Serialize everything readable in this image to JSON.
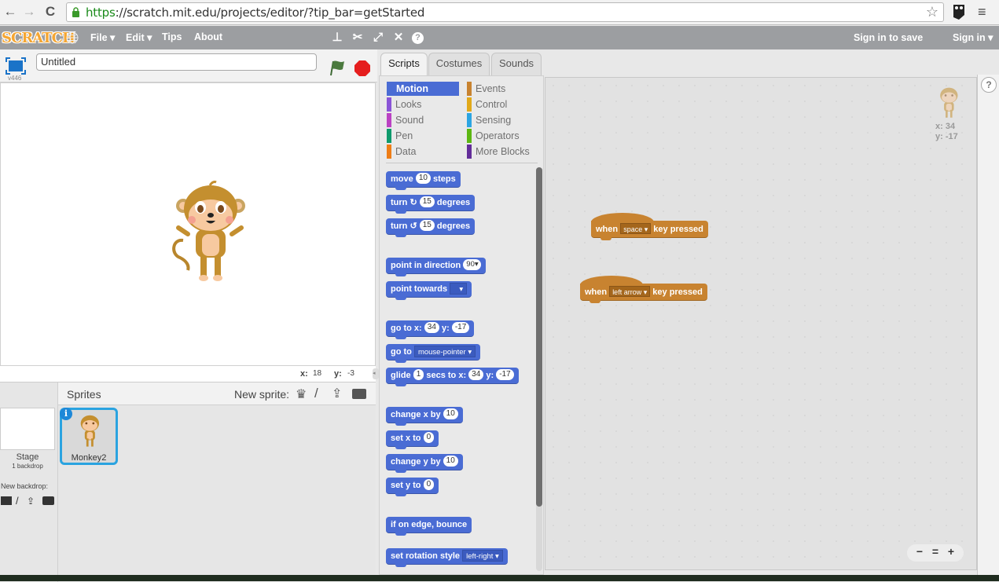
{
  "browser": {
    "url_protocol": "https",
    "url_rest": "://scratch.mit.edu/projects/editor/?tip_bar=getStarted",
    "icons": [
      "back-icon",
      "forward-icon",
      "reload-icon",
      "lock-icon",
      "star-icon",
      "extension-owl-icon",
      "menu-icon"
    ]
  },
  "menubar": {
    "logo": "SCRATCH",
    "file": "File ▾",
    "edit": "Edit ▾",
    "tips": "Tips",
    "about": "About",
    "sign_in_to_save": "Sign in to save",
    "sign_in": "Sign in ▾",
    "tool_icons": [
      "duplicate-stamp-icon",
      "cut-scissors-icon",
      "grow-icon",
      "shrink-icon",
      "help-icon"
    ]
  },
  "stage": {
    "version": "v446",
    "project_title": "Untitled",
    "mouse_x_label": "x:",
    "mouse_x": "18",
    "mouse_y_label": "y:",
    "mouse_y": "-3"
  },
  "sprites_pane": {
    "title": "Sprites",
    "new_sprite_label": "New sprite:",
    "stage_label": "Stage",
    "stage_backdrops": "1 backdrop",
    "new_backdrop_label": "New backdrop:",
    "sprites": [
      {
        "name": "Monkey2",
        "selected": true
      }
    ]
  },
  "tabs": [
    {
      "label": "Scripts",
      "active": true
    },
    {
      "label": "Costumes",
      "active": false
    },
    {
      "label": "Sounds",
      "active": false
    }
  ],
  "categories": [
    {
      "label": "Motion",
      "color": "#4a6cd4",
      "active": true
    },
    {
      "label": "Looks",
      "color": "#8a55d7"
    },
    {
      "label": "Sound",
      "color": "#bb42c3"
    },
    {
      "label": "Pen",
      "color": "#0e9a6c"
    },
    {
      "label": "Data",
      "color": "#ee7d16"
    },
    {
      "label": "Events",
      "color": "#c88330"
    },
    {
      "label": "Control",
      "color": "#e1a91a"
    },
    {
      "label": "Sensing",
      "color": "#2ca5e2"
    },
    {
      "label": "Operators",
      "color": "#5cb712"
    },
    {
      "label": "More Blocks",
      "color": "#632d99"
    }
  ],
  "blocks": {
    "move": {
      "a": "move",
      "v": "10",
      "b": "steps"
    },
    "turn_right": {
      "a": "turn",
      "v": "15",
      "b": "degrees"
    },
    "turn_left": {
      "a": "turn",
      "v": "15",
      "b": "degrees"
    },
    "point_dir": {
      "a": "point in direction",
      "v": "90▾"
    },
    "point_towards": {
      "a": "point towards",
      "v": "▾"
    },
    "goto_xy": {
      "a": "go to x:",
      "x": "34",
      "b": "y:",
      "y": "-17"
    },
    "goto": {
      "a": "go to",
      "v": "mouse-pointer ▾"
    },
    "glide": {
      "a": "glide",
      "s": "1",
      "b": "secs to x:",
      "x": "34",
      "c": "y:",
      "y": "-17"
    },
    "change_x": {
      "a": "change x by",
      "v": "10"
    },
    "set_x": {
      "a": "set x to",
      "v": "0"
    },
    "change_y": {
      "a": "change y by",
      "v": "10"
    },
    "set_y": {
      "a": "set y to",
      "v": "0"
    },
    "bounce": {
      "a": "if on edge, bounce"
    },
    "rotation": {
      "a": "set rotation style",
      "v": "left-right ▾"
    }
  },
  "scripts": [
    {
      "when": "when",
      "key": "space ▾",
      "rest": "key pressed"
    },
    {
      "when": "when",
      "key": "left arrow ▾",
      "rest": "key pressed"
    }
  ],
  "sprite_info": {
    "x": "x: 34",
    "y": "y: -17"
  },
  "zoom_controls": {
    "out": "−",
    "reset": "=",
    "in": "+"
  },
  "help": "?"
}
